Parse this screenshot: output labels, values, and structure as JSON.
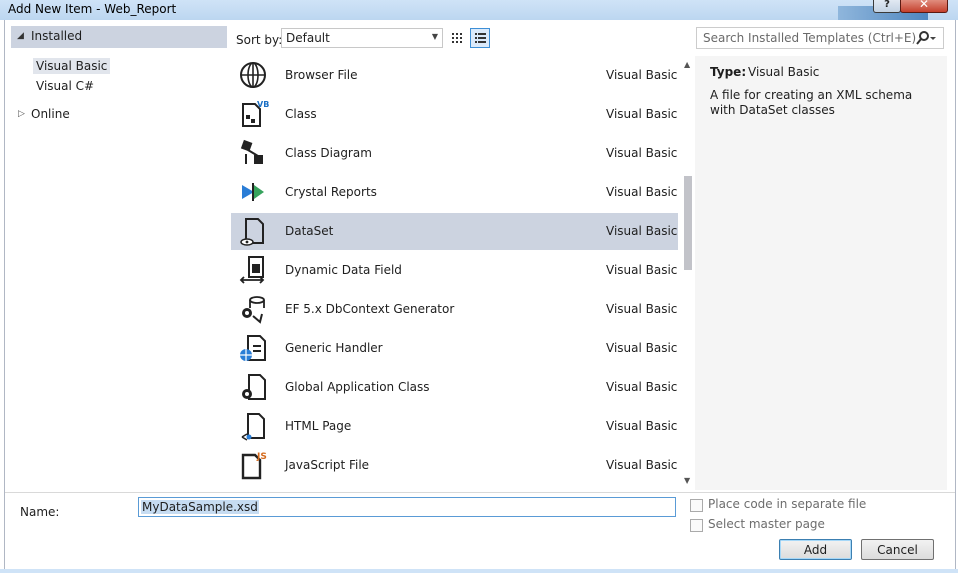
{
  "window": {
    "title": "Add New Item - Web_Report"
  },
  "tree": {
    "installed": "Installed",
    "children": [
      "Visual Basic",
      "Visual C#"
    ],
    "online": "Online"
  },
  "sort": {
    "label": "Sort by:",
    "value": "Default"
  },
  "search": {
    "placeholder": "Search Installed Templates (Ctrl+E)"
  },
  "templates": [
    {
      "name": "Browser File",
      "lang": "Visual Basic",
      "icon": "browser-file-icon"
    },
    {
      "name": "Class",
      "lang": "Visual Basic",
      "icon": "class-icon"
    },
    {
      "name": "Class Diagram",
      "lang": "Visual Basic",
      "icon": "class-diagram-icon"
    },
    {
      "name": "Crystal Reports",
      "lang": "Visual Basic",
      "icon": "crystal-reports-icon"
    },
    {
      "name": "DataSet",
      "lang": "Visual Basic",
      "icon": "dataset-icon",
      "selected": true
    },
    {
      "name": "Dynamic Data Field",
      "lang": "Visual Basic",
      "icon": "dynamic-data-field-icon"
    },
    {
      "name": "EF 5.x DbContext Generator",
      "lang": "Visual Basic",
      "icon": "ef-generator-icon"
    },
    {
      "name": "Generic Handler",
      "lang": "Visual Basic",
      "icon": "generic-handler-icon"
    },
    {
      "name": "Global Application Class",
      "lang": "Visual Basic",
      "icon": "global-app-class-icon"
    },
    {
      "name": "HTML Page",
      "lang": "Visual Basic",
      "icon": "html-page-icon"
    },
    {
      "name": "JavaScript File",
      "lang": "Visual Basic",
      "icon": "javascript-file-icon"
    }
  ],
  "details": {
    "type_label": "Type:",
    "type_value": "Visual Basic",
    "description": "A file for creating an XML schema with DataSet classes"
  },
  "form": {
    "name_label": "Name:",
    "name_value": "MyDataSample.xsd",
    "place_code_label": "Place code in separate file",
    "master_page_label": "Select master page",
    "add_label": "Add",
    "cancel_label": "Cancel"
  }
}
